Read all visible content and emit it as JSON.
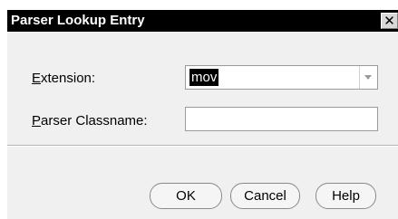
{
  "dialog": {
    "title": "Parser Lookup Entry",
    "close_glyph": "✕"
  },
  "form": {
    "extension": {
      "label_mnemonic": "E",
      "label_rest": "xtension:",
      "value": "mov"
    },
    "parser_classname": {
      "label_mnemonic": "P",
      "label_rest": "arser Classname:",
      "value": ""
    }
  },
  "buttons": {
    "ok": "OK",
    "cancel": "Cancel",
    "help": "Help"
  },
  "icons": {
    "close": "close-icon",
    "dropdown": "chevron-down-icon"
  }
}
